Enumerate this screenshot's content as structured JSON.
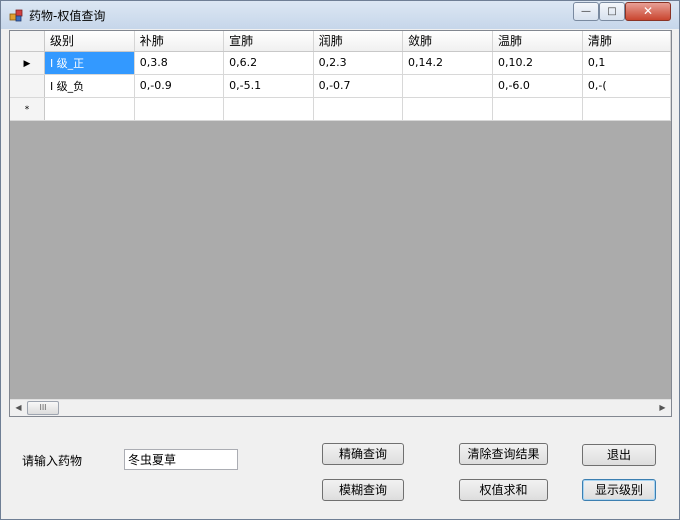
{
  "window": {
    "title": "药物-权值查询",
    "controls": {
      "minimize": "—",
      "maximize": "□",
      "close": "✕"
    }
  },
  "grid": {
    "columns": [
      "级别",
      "补肺",
      "宣肺",
      "润肺",
      "敛肺",
      "温肺",
      "清肺"
    ],
    "rows": [
      {
        "marker": "▶",
        "cells": [
          "I 级_正",
          "0,3.8",
          "0,6.2",
          "0,2.3",
          "0,14.2",
          "0,10.2",
          "0,1"
        ]
      },
      {
        "marker": "",
        "cells": [
          "I 级_负",
          "0,-0.9",
          "0,-5.1",
          "0,-0.7",
          "",
          "0,-6.0",
          "0,-("
        ]
      },
      {
        "marker": "*",
        "cells": [
          "",
          "",
          "",
          "",
          "",
          "",
          ""
        ]
      }
    ],
    "selected_cell": "row0-col0",
    "scroll": {
      "left_arrow": "◀",
      "right_arrow": "▶",
      "thumb_grip": "III"
    }
  },
  "form": {
    "drug_label": "请输入药物",
    "drug_value": "冬虫夏草"
  },
  "buttons": {
    "exact_query": "精确查询",
    "clear_results": "清除查询结果",
    "exit": "退出",
    "fuzzy_query": "模糊查询",
    "weight_sum": "权值求和",
    "show_level": "显示级别"
  }
}
